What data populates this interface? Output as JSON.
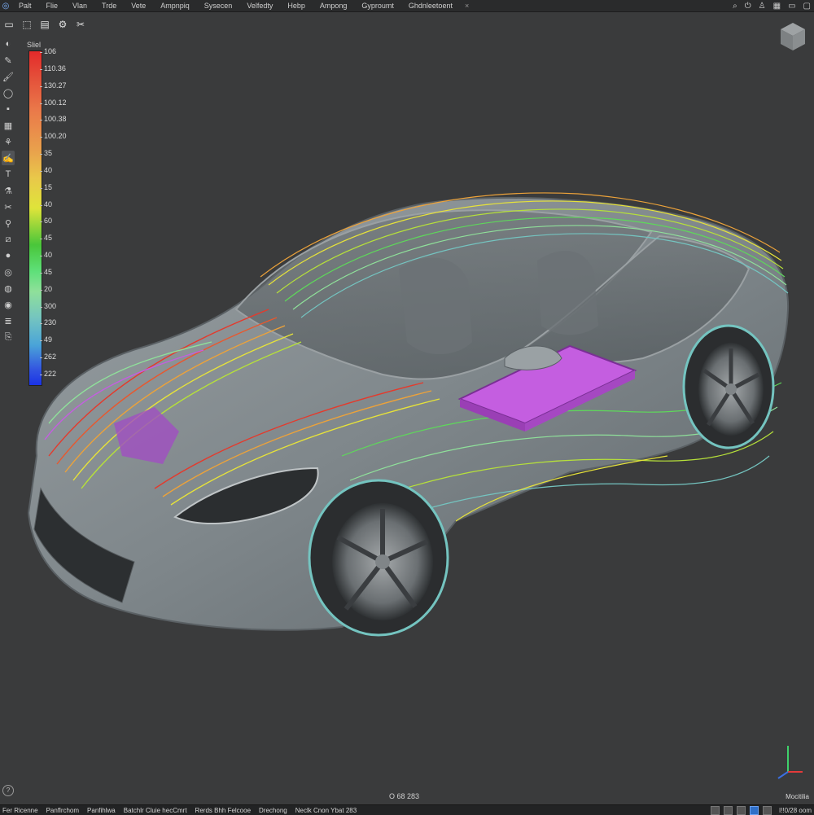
{
  "menubar": {
    "app_icon": "app-logo-icon",
    "items": [
      "Palt",
      "Flie",
      "Vlan",
      "Trde",
      "Vete",
      "Ampnpiq",
      "Sysecen",
      "Velfedty",
      "Hebp",
      "Ampong",
      "Gyproumt",
      "Ghdnleetoent"
    ],
    "close_glyph": "×",
    "window_icons": [
      "search-icon",
      "power-icon",
      "user-icon",
      "grid-icon",
      "minimize-icon",
      "maximize-icon"
    ]
  },
  "toolbar": {
    "buttons": [
      "window-icon",
      "select-icon",
      "layout-icon",
      "settings-icon",
      "tools-icon"
    ]
  },
  "left_tools": [
    "orbit-icon",
    "pencil-icon",
    "brush-icon",
    "lasso-icon",
    "sheet-icon",
    "grid-icon",
    "layers-icon",
    "flow-icon",
    "text-icon",
    "measure-icon",
    "cut-icon",
    "probe-icon",
    "slice-icon",
    "sphere-icon",
    "camera-icon",
    "cursor-icon",
    "record-icon",
    "stack-icon",
    "export-icon"
  ],
  "legend": {
    "title": "Sliel",
    "ticks": [
      "106",
      "110.36",
      "130.27",
      "100.12",
      "100.38",
      "100.20",
      "35",
      "40",
      "15",
      "40",
      "60",
      "45",
      "40",
      "45",
      "20",
      "300",
      "230",
      "49",
      "262",
      "222"
    ]
  },
  "viewport": {
    "coord_readout": "O 68 283",
    "mode_label": "Mocitilia",
    "help_glyph": "?",
    "colors": {
      "background": "#3a3b3c",
      "body": "#8e9598",
      "streamline_red": "#e43a2c",
      "streamline_yellow": "#e6e23a",
      "streamline_green": "#5ed85a",
      "battery_purple": "#c45ee0"
    }
  },
  "statusbar": {
    "items": [
      "Fer Ricenne",
      "Panflrchom",
      "Panfihlwa",
      "Batchlr Cluie hecCmrt",
      "Rerds Bhh Felcooe",
      "Drechong",
      "Neclk Cnon  Ybat 283"
    ],
    "clock": "I!!0/28 oom"
  }
}
